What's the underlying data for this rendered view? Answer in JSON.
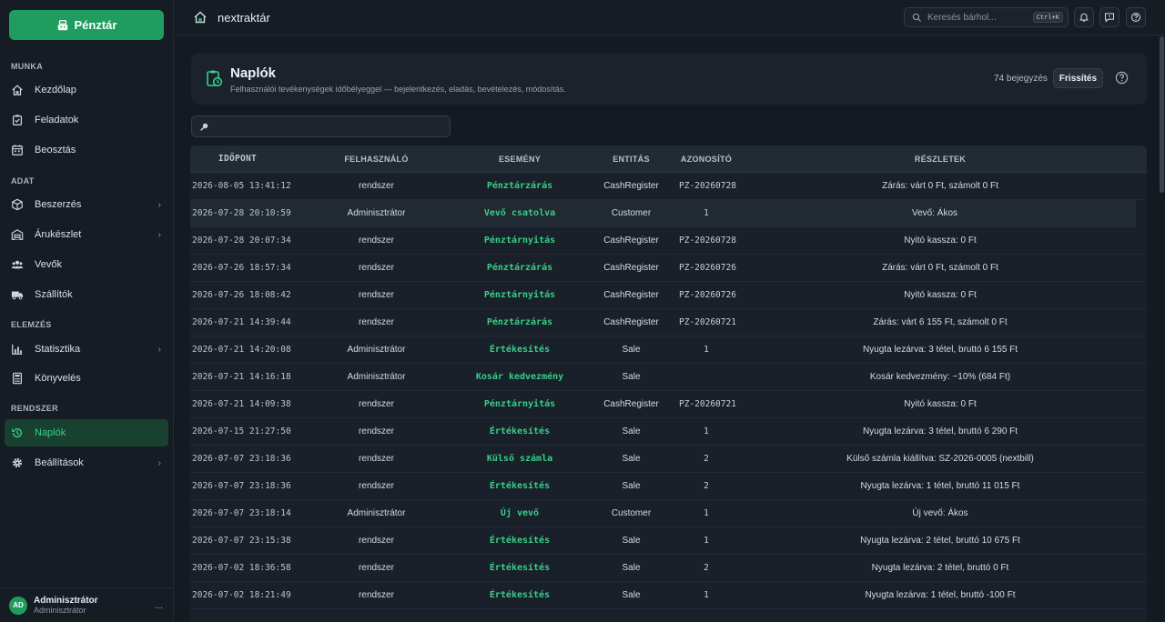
{
  "sidebar": {
    "pos_button": "Pénztár",
    "sections": {
      "munka": "MUNKA",
      "adat": "ADAT",
      "elemzes": "ELEMZÉS",
      "rendszer": "RENDSZER"
    },
    "items": [
      {
        "label": "Kezdőlap",
        "icon": "home-icon"
      },
      {
        "label": "Feladatok",
        "icon": "tasks-icon"
      },
      {
        "label": "Beosztás",
        "icon": "calendar-icon"
      },
      {
        "label": "Beszerzés",
        "icon": "box-icon"
      },
      {
        "label": "Árukészlet",
        "icon": "warehouse-icon"
      },
      {
        "label": "Vevők",
        "icon": "users-icon"
      },
      {
        "label": "Szállítók",
        "icon": "truck-icon"
      },
      {
        "label": "Statisztika",
        "icon": "bar-chart-icon"
      },
      {
        "label": "Könyvelés",
        "icon": "calculator-icon"
      },
      {
        "label": "Naplók",
        "icon": "history-icon"
      },
      {
        "label": "Beállítások",
        "icon": "gear-icon"
      }
    ],
    "user": {
      "initials": "AD",
      "name": "Adminisztrátor",
      "role": "Adminisztrátor",
      "more": "..."
    }
  },
  "topbar": {
    "brand": "nextraktár",
    "search_placeholder": "Keresés bárhol...",
    "search_shortcut": "Ctrl+K"
  },
  "header": {
    "title": "Naplók",
    "subtitle": "Felhasználói tevékenységek időbélyeggel — bejelentkezés, eladás, bevételezés, módosítás.",
    "count": "74 bejegyzés",
    "refresh": "Frissítés"
  },
  "filter": {
    "value": ""
  },
  "table": {
    "columns": [
      "IDŐPONT",
      "FELHASZNÁLÓ",
      "ESEMÉNY",
      "ENTITÁS",
      "AZONOSÍTÓ",
      "RÉSZLETEK"
    ],
    "rows": [
      {
        "time": "2026-08-05 13:41:12",
        "user": "rendszer",
        "event": "Pénztárzárás",
        "entity": "CashRegister",
        "id": "PZ-20260728",
        "details": "Zárás: várt 0 Ft, számolt 0 Ft"
      },
      {
        "time": "2026-07-28 20:10:59",
        "user": "Adminisztrátor",
        "event": "Vevő csatolva",
        "entity": "Customer",
        "id": "1",
        "details": "Vevő: Ákos"
      },
      {
        "time": "2026-07-28 20:07:34",
        "user": "rendszer",
        "event": "Pénztárnyitás",
        "entity": "CashRegister",
        "id": "PZ-20260728",
        "details": "Nyitó kassza: 0 Ft"
      },
      {
        "time": "2026-07-26 18:57:34",
        "user": "rendszer",
        "event": "Pénztárzárás",
        "entity": "CashRegister",
        "id": "PZ-20260726",
        "details": "Zárás: várt 0 Ft, számolt 0 Ft"
      },
      {
        "time": "2026-07-26 18:08:42",
        "user": "rendszer",
        "event": "Pénztárnyitás",
        "entity": "CashRegister",
        "id": "PZ-20260726",
        "details": "Nyitó kassza: 0 Ft"
      },
      {
        "time": "2026-07-21 14:39:44",
        "user": "rendszer",
        "event": "Pénztárzárás",
        "entity": "CashRegister",
        "id": "PZ-20260721",
        "details": "Zárás: várt 6 155 Ft, számolt 0 Ft"
      },
      {
        "time": "2026-07-21 14:20:08",
        "user": "Adminisztrátor",
        "event": "Értékesítés",
        "entity": "Sale",
        "id": "1",
        "details": "Nyugta lezárva: 3 tétel, bruttó 6 155 Ft"
      },
      {
        "time": "2026-07-21 14:16:18",
        "user": "Adminisztrátor",
        "event": "Kosár kedvezmény",
        "entity": "Sale",
        "id": "",
        "details": "Kosár kedvezmény: −10% (684 Ft)"
      },
      {
        "time": "2026-07-21 14:09:38",
        "user": "rendszer",
        "event": "Pénztárnyitás",
        "entity": "CashRegister",
        "id": "PZ-20260721",
        "details": "Nyitó kassza: 0 Ft"
      },
      {
        "time": "2026-07-15 21:27:50",
        "user": "rendszer",
        "event": "Értékesítés",
        "entity": "Sale",
        "id": "1",
        "details": "Nyugta lezárva: 3 tétel, bruttó 6 290 Ft"
      },
      {
        "time": "2026-07-07 23:18:36",
        "user": "rendszer",
        "event": "Külső számla",
        "entity": "Sale",
        "id": "2",
        "details": "Külső számla kiállítva: SZ-2026-0005 (nextbill)"
      },
      {
        "time": "2026-07-07 23:18:36",
        "user": "rendszer",
        "event": "Értékesítés",
        "entity": "Sale",
        "id": "2",
        "details": "Nyugta lezárva: 1 tétel, bruttó 11 015 Ft"
      },
      {
        "time": "2026-07-07 23:18:14",
        "user": "Adminisztrátor",
        "event": "Új vevő",
        "entity": "Customer",
        "id": "1",
        "details": "Új vevő: Ákos"
      },
      {
        "time": "2026-07-07 23:15:38",
        "user": "rendszer",
        "event": "Értékesítés",
        "entity": "Sale",
        "id": "1",
        "details": "Nyugta lezárva: 2 tétel, bruttó 10 675 Ft"
      },
      {
        "time": "2026-07-02 18:36:58",
        "user": "rendszer",
        "event": "Értékesítés",
        "entity": "Sale",
        "id": "2",
        "details": "Nyugta lezárva: 2 tétel, bruttó 0 Ft"
      },
      {
        "time": "2026-07-02 18:21:49",
        "user": "rendszer",
        "event": "Értékesítés",
        "entity": "Sale",
        "id": "1",
        "details": "Nyugta lezárva: 1 tétel, bruttó -100 Ft"
      }
    ]
  },
  "colors": {
    "accent": "#1f9d5e",
    "event_text": "#35cf88",
    "background": "#141a22"
  }
}
